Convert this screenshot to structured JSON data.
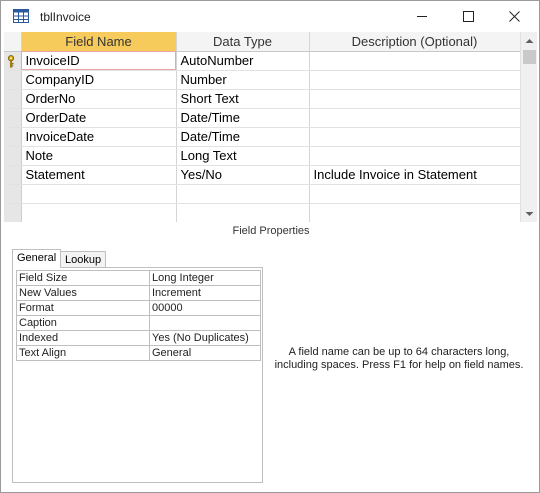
{
  "window": {
    "title": "tblInvoice"
  },
  "grid": {
    "columns": [
      "Field Name",
      "Data Type",
      "Description (Optional)"
    ],
    "rows": [
      {
        "field": "InvoiceID",
        "type": "AutoNumber",
        "description": ""
      },
      {
        "field": "CompanyID",
        "type": "Number",
        "description": ""
      },
      {
        "field": "OrderNo",
        "type": "Short Text",
        "description": ""
      },
      {
        "field": "OrderDate",
        "type": "Date/Time",
        "description": ""
      },
      {
        "field": "InvoiceDate",
        "type": "Date/Time",
        "description": ""
      },
      {
        "field": "Note",
        "type": "Long Text",
        "description": ""
      },
      {
        "field": "Statement",
        "type": "Yes/No",
        "description": "Include Invoice in Statement"
      },
      {
        "field": "",
        "type": "",
        "description": ""
      },
      {
        "field": "",
        "type": "",
        "description": ""
      }
    ]
  },
  "field_properties_label": "Field Properties",
  "tabs": {
    "general": "General",
    "lookup": "Lookup"
  },
  "properties": [
    {
      "name": "Field Size",
      "value": "Long Integer"
    },
    {
      "name": "New Values",
      "value": "Increment"
    },
    {
      "name": "Format",
      "value": "00000"
    },
    {
      "name": "Caption",
      "value": ""
    },
    {
      "name": "Indexed",
      "value": "Yes (No Duplicates)"
    },
    {
      "name": "Text Align",
      "value": "General"
    }
  ],
  "help_text": "A field name can be up to 64 characters long, including spaces. Press F1 for help on field names.",
  "icons": {
    "title": "table-icon",
    "key": "primary-key-icon"
  },
  "colors": {
    "active_header": "#f6cb5b",
    "selector": "#e6e6e6"
  }
}
